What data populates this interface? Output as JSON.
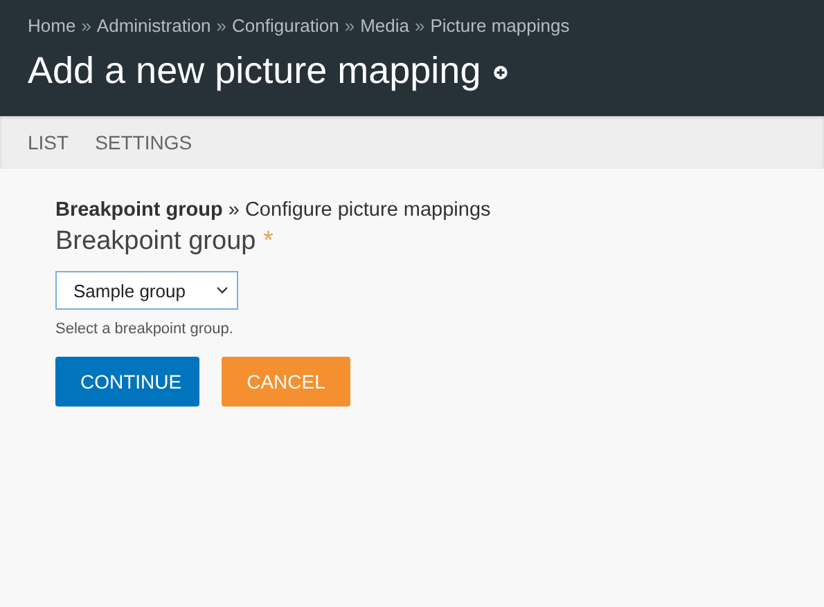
{
  "breadcrumb": [
    "Home",
    "Administration",
    "Configuration",
    "Media",
    "Picture mappings"
  ],
  "breadcrumb_separator": "»",
  "title": "Add a new picture mapping",
  "tabs": [
    {
      "label": "LIST",
      "selected": false
    },
    {
      "label": "SETTINGS",
      "selected": false
    }
  ],
  "steps": "**Breakpoint group** » Configure picture mappings",
  "field": {
    "label": "Breakpoint group",
    "required_mark": "*",
    "value": "Sample group",
    "help": "Select a breakpoint group."
  },
  "buttons": [
    {
      "label": "CONTINUE",
      "kind": "primary"
    },
    {
      "label": "CANCEL",
      "kind": "danger"
    }
  ]
}
